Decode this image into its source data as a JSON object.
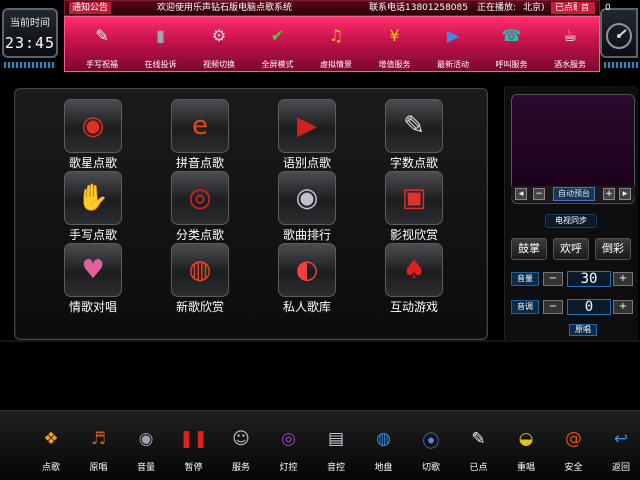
{
  "clock": {
    "title": "当前时间",
    "time": "23:45"
  },
  "ticker": {
    "notice_label": "通知公告",
    "welcome": "欢迎使用乐声钻石版电脑点歌系统",
    "phone": "联系电话13801258085",
    "playing_label": "正在播放:",
    "now_playing": "北京)",
    "ordered_label": "已点歌曲",
    "ordered_count": "0",
    "home_label": "首"
  },
  "topnav": {
    "items": [
      {
        "label": "手写祝福",
        "icon": "notepad-icon",
        "glyph": "✎",
        "color": "#f2f2f2"
      },
      {
        "label": "在线投诉",
        "icon": "book-icon",
        "glyph": "▮",
        "color": "#9aa6b4"
      },
      {
        "label": "视频切换",
        "icon": "gear-icon",
        "glyph": "⚙",
        "color": "#d6dbe0"
      },
      {
        "label": "全屏模式",
        "icon": "checkmark-icon",
        "glyph": "✔",
        "color": "#4ac94a"
      },
      {
        "label": "虚拟情景",
        "icon": "music-note-icon",
        "glyph": "♫",
        "color": "#f0c020"
      },
      {
        "label": "增值服务",
        "icon": "yen-coin-icon",
        "glyph": "¥",
        "color": "#f0c020"
      },
      {
        "label": "最新活动",
        "icon": "media-player-icon",
        "glyph": "▶",
        "color": "#3a8fe0"
      },
      {
        "label": "呼叫服务",
        "icon": "telephone-icon",
        "glyph": "☎",
        "color": "#20c0b0"
      },
      {
        "label": "酒水服务",
        "icon": "coffee-cup-icon",
        "glyph": "☕",
        "color": "#ffffff"
      }
    ]
  },
  "grid": {
    "tiles": [
      {
        "label": "歌星点歌",
        "icon": "singer-icon",
        "glyph": "◉",
        "color": "#e03020"
      },
      {
        "label": "拼音点歌",
        "icon": "pinyin-icon",
        "glyph": "e",
        "color": "#e84a10"
      },
      {
        "label": "语别点歌",
        "icon": "language-icon",
        "glyph": "▶",
        "color": "#d02020"
      },
      {
        "label": "字数点歌",
        "icon": "text-count-icon",
        "glyph": "✎",
        "color": "#e0e0e0"
      },
      {
        "label": "手写点歌",
        "icon": "handwrite-icon",
        "glyph": "✋",
        "color": "#d02020"
      },
      {
        "label": "分类点歌",
        "icon": "category-icon",
        "glyph": "◎",
        "color": "#e02020"
      },
      {
        "label": "歌曲排行",
        "icon": "ranking-disc-icon",
        "glyph": "◉",
        "color": "#c0c0d0"
      },
      {
        "label": "影视欣赏",
        "icon": "movie-icon",
        "glyph": "▣",
        "color": "#e03030"
      },
      {
        "label": "情歌对唱",
        "icon": "love-disc-icon",
        "glyph": "♥",
        "color": "#e060a0"
      },
      {
        "label": "新歌欣赏",
        "icon": "new-song-icon",
        "glyph": "◍",
        "color": "#f04020"
      },
      {
        "label": "私人歌库",
        "icon": "private-library-icon",
        "glyph": "◐",
        "color": "#f04040"
      },
      {
        "label": "互动游戏",
        "icon": "game-icon",
        "glyph": "♠",
        "color": "#e02020"
      }
    ]
  },
  "video": {
    "auto_label": "自动预台",
    "minus": "−",
    "plus": "+",
    "sync_label": "电视同步"
  },
  "actions": [
    {
      "label": "鼓掌"
    },
    {
      "label": "欢呼"
    },
    {
      "label": "倒彩"
    }
  ],
  "volume": {
    "label": "音量",
    "value": "30",
    "minus": "−",
    "plus": "+"
  },
  "tone": {
    "label": "音调",
    "value": "0",
    "minus": "−",
    "plus": "+"
  },
  "original": {
    "label": "原唱"
  },
  "dock": {
    "items": [
      {
        "label": "点歌",
        "icon": "windows-flag-icon",
        "glyph": "❖",
        "color": "#f0a020"
      },
      {
        "label": "原唱",
        "icon": "guitar-icon",
        "glyph": "♬",
        "color": "#c06020"
      },
      {
        "label": "音量",
        "icon": "speaker-icon",
        "glyph": "◉",
        "color": "#a0a0b0"
      },
      {
        "label": "暂停",
        "icon": "pause-icon",
        "glyph": "❚❚",
        "color": "#e02020"
      },
      {
        "label": "服务",
        "icon": "waiter-icon",
        "glyph": "☺",
        "color": "#c0c0c0"
      },
      {
        "label": "灯控",
        "icon": "light-lens-icon",
        "glyph": "◎",
        "color": "#a040c0"
      },
      {
        "label": "音控",
        "icon": "equalizer-icon",
        "glyph": "▤",
        "color": "#d0d0e0"
      },
      {
        "label": "地盘",
        "icon": "globe-icon",
        "glyph": "◍",
        "color": "#3a8ae0"
      },
      {
        "label": "切歌",
        "icon": "skip-disc-icon",
        "glyph": "⦿",
        "color": "#4a90e0"
      },
      {
        "label": "已点",
        "icon": "pencil-note-icon",
        "glyph": "✎",
        "color": "#f0f0f0"
      },
      {
        "label": "重唱",
        "icon": "repeat-disc-icon",
        "glyph": "◒",
        "color": "#e0c020"
      },
      {
        "label": "安全",
        "icon": "security-book-icon",
        "glyph": "@",
        "color": "#e05020"
      },
      {
        "label": "返回",
        "icon": "back-arrow-icon",
        "glyph": "↩",
        "color": "#3a8ae0"
      }
    ]
  }
}
